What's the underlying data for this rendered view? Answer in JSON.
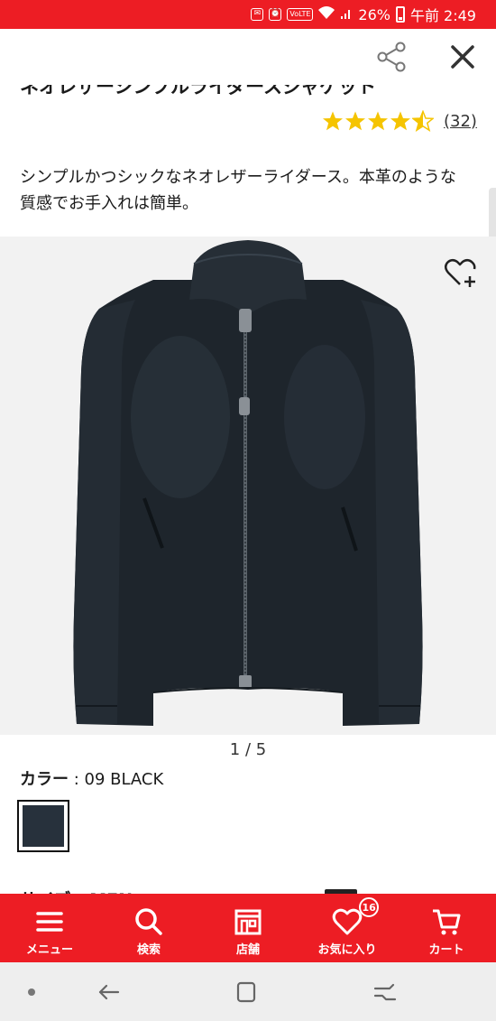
{
  "status_bar": {
    "battery": "26%",
    "time": "午前 2:49",
    "volte": "VoLTE",
    "background_color": "#ed1d24"
  },
  "header": {
    "title": "ネオレザーシンプルライダースジャケット",
    "share_icon": "share-icon",
    "close_icon": "close-icon"
  },
  "rating": {
    "stars": 4.5,
    "star_color": "#f5c400",
    "review_count": "(32)"
  },
  "product": {
    "description": "シンプルかつシックなネオレザーライダース。本革のような質感でお手入れは簡単。",
    "wishlist_icon": "heart-plus-icon",
    "image_counter": "1 / 5"
  },
  "color": {
    "label": "カラー",
    "separator": " : ",
    "value": "09 BLACK",
    "swatch_color": "#27313c"
  },
  "size": {
    "label_partial": "サイズ : MEN"
  },
  "bottom_nav": {
    "background_color": "#ed1d24",
    "items": [
      {
        "label": "メニュー",
        "icon": "menu-icon"
      },
      {
        "label": "検索",
        "icon": "search-icon"
      },
      {
        "label": "店舗",
        "icon": "store-icon"
      },
      {
        "label": "お気に入り",
        "icon": "heart-icon",
        "badge": "16"
      },
      {
        "label": "カート",
        "icon": "cart-icon"
      }
    ]
  },
  "system_nav": {
    "icons": [
      "dot-icon",
      "back-icon",
      "home-icon",
      "recents-icon"
    ]
  }
}
